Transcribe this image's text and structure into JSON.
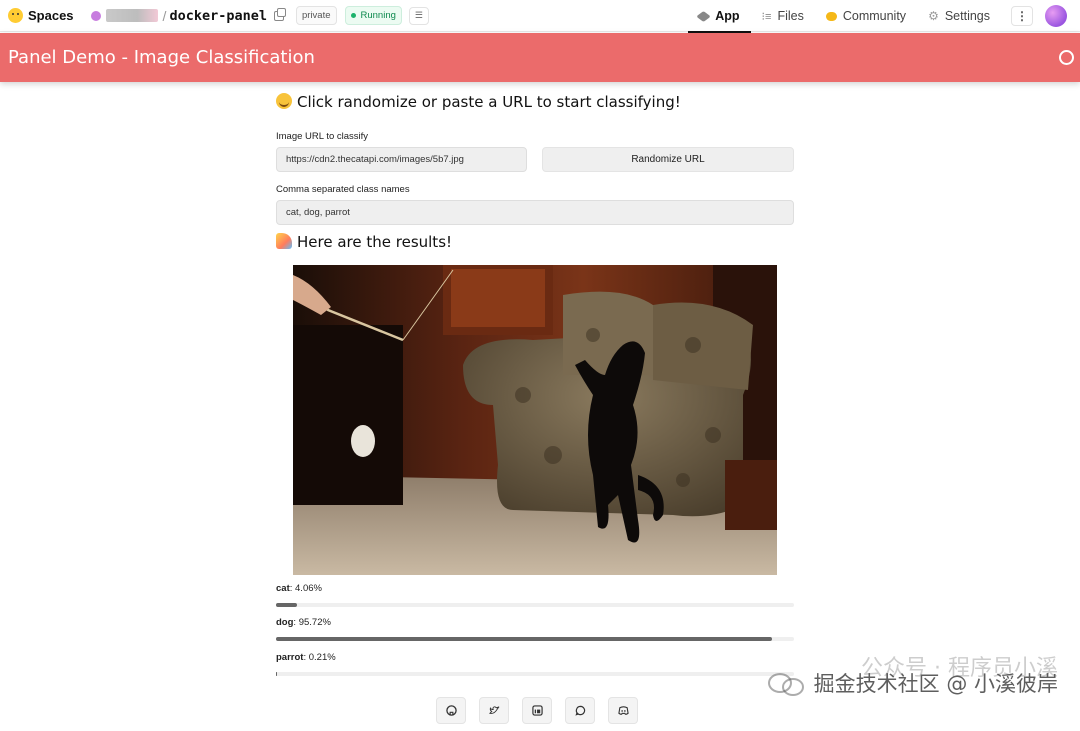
{
  "topbar": {
    "brand": "Spaces",
    "repo_name": "docker-panel",
    "visibility_badge": "private",
    "status_badge": "Running",
    "nav": [
      {
        "label": "App",
        "icon": "app-icon",
        "active": true
      },
      {
        "label": "Files",
        "icon": "files-icon",
        "active": false
      },
      {
        "label": "Community",
        "icon": "community-icon",
        "active": false
      },
      {
        "label": "Settings",
        "icon": "gear-icon",
        "active": false
      }
    ]
  },
  "panel": {
    "title": "Panel Demo - Image Classification",
    "header_color": "#eb6b6b"
  },
  "main": {
    "prompt": "Click randomize or paste a URL to start classifying!",
    "url_label": "Image URL to classify",
    "url_value": "https://cdn2.thecatapi.com/images/5b7.jpg",
    "randomize_label": "Randomize URL",
    "classes_label": "Comma separated class names",
    "classes_value": "cat, dog, parrot",
    "results_heading": "Here are the results!",
    "results": [
      {
        "name": "cat",
        "value": "4.06%",
        "fraction": 0.0406
      },
      {
        "name": "dog",
        "value": "95.72%",
        "fraction": 0.9572
      },
      {
        "name": "parrot",
        "value": "0.21%",
        "fraction": 0.0021
      }
    ]
  },
  "footer_icons": [
    "github-icon",
    "twitter-icon",
    "linkedin-icon",
    "discourse-icon",
    "discord-icon"
  ],
  "watermark": {
    "line1": "公众号 · 程序员小溪",
    "line2": "掘金技术社区 @ 小溪彼岸"
  }
}
